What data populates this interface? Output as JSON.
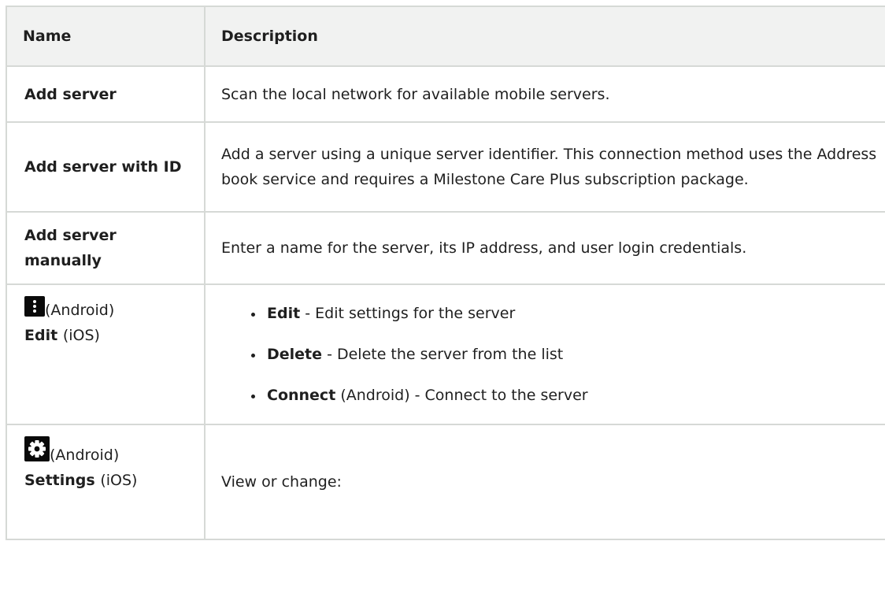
{
  "table": {
    "headers": {
      "name": "Name",
      "description": "Description"
    },
    "rows": [
      {
        "name": "Add server",
        "description": "Scan the local network for available mobile servers."
      },
      {
        "name": "Add server with ID",
        "description": "Add a server using a unique server identifier. This connection method uses the Address book service and requires a Milestone Care Plus subscription package."
      },
      {
        "name": "Add server manually",
        "description": "Enter a name for the server, its IP address, and user login credentials."
      },
      {
        "icon": "kebab-menu-icon",
        "android_label": "(Android)",
        "ios_bold": "Edit",
        "ios_suffix": "(iOS)",
        "options": [
          {
            "bold": "Edit",
            "rest": " - Edit settings for the server"
          },
          {
            "bold": "Delete",
            "rest": " - Delete the server from the list"
          },
          {
            "bold": "Connect",
            "rest": " (Android) - Connect to the server"
          }
        ]
      },
      {
        "icon": "gear-icon",
        "android_label": "(Android)",
        "ios_bold": "Settings",
        "ios_suffix": "(iOS)",
        "description": "View or change:"
      }
    ]
  }
}
